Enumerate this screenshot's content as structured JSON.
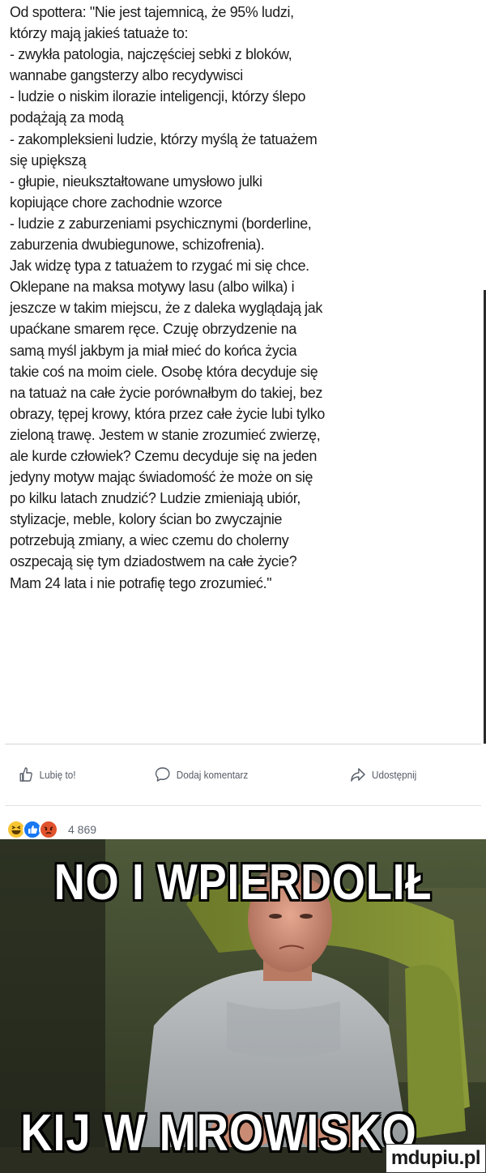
{
  "post": {
    "lines": [
      "Od spottera: \"Nie jest tajemnicą, że 95% ludzi,",
      "którzy mają jakieś tatuaże to:",
      "- zwykła patologia, najczęściej sebki z bloków,",
      "wannabe gangsterzy albo recydywisci",
      "- ludzie o niskim ilorazie inteligencji, którzy ślepo",
      "podążają za modą",
      "- zakompleksieni ludzie, którzy myślą że tatuażem",
      "się upiększą",
      "- głupie, nieukształtowane umysłowo julki",
      "kopiujące chore zachodnie wzorce",
      "- ludzie z zaburzeniami psychicznymi (borderline,",
      "zaburzenia dwubiegunowe, schizofrenia).",
      "Jak widzę typa z tatuażem to rzygać mi się chce.",
      "Oklepane na maksa motywy lasu (albo wilka) i",
      "jeszcze w takim miejscu, że z daleka wyglądają jak",
      "upaćkane smarem ręce. Czuję obrzydzenie na",
      "samą myśl jakbym ja miał mieć do końca życia",
      "takie coś na moim ciele. Osobę która decyduje się",
      "na tatuaż na całe życie porównałbym do takiej, bez",
      "obrazy, tępej krowy, która przez całe życie lubi tylko",
      "zieloną trawę. Jestem w stanie zrozumieć zwierzę,",
      "ale kurde człowiek? Czemu decyduje się na jeden",
      "jedyny motyw mając świadomość że może on się",
      "po kilku latach znudzić? Ludzie zmieniają ubiór,",
      "stylizacje, meble, kolory ścian bo zwyczajnie",
      "potrzebują zmiany, a wiec czemu do cholerny",
      "oszpecają się tym dziadostwem na całe życie?",
      "Mam 24 lata i nie potrafię tego zrozumieć.\""
    ]
  },
  "actions": {
    "like_label": "Lubię to!",
    "comment_label": "Dodaj komentarz",
    "share_label": "Udostępnij"
  },
  "reactions": {
    "count": "4 869",
    "icons": [
      "haha-icon",
      "like-icon",
      "angry-icon"
    ]
  },
  "meme": {
    "top_text": "NO I WPIERDOLIŁ",
    "bottom_text": "KIJ W MROWISKO"
  },
  "watermark": {
    "text": "mdupiu.pl"
  },
  "colors": {
    "like_blue": "#1877f2",
    "haha_yellow": "#f7c533",
    "angry_red": "#e0522d"
  }
}
